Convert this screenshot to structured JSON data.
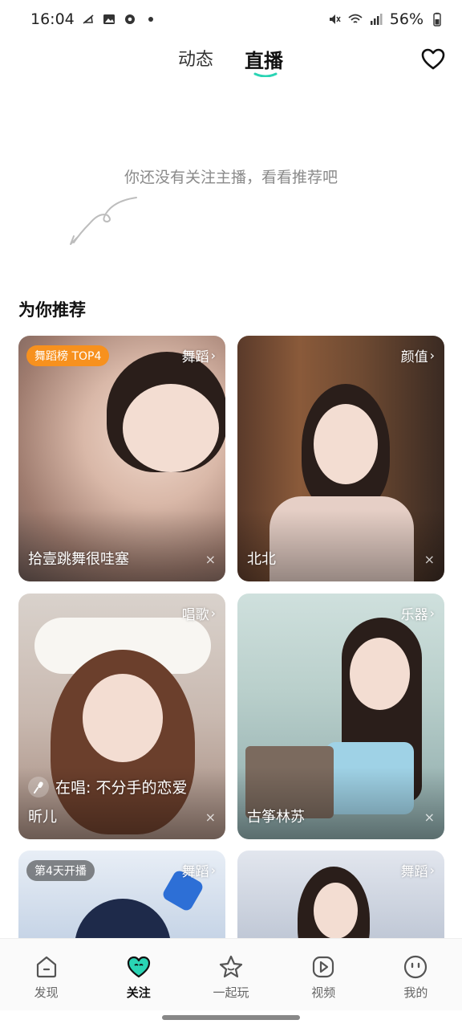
{
  "status_bar": {
    "time": "16:04",
    "battery": "56%",
    "left_icons": [
      "notification-muted-icon",
      "image-icon",
      "gear-icon",
      "dot-icon"
    ],
    "right_icons": [
      "vibrate-icon",
      "wifi-icon",
      "signal-icon",
      "battery-icon"
    ]
  },
  "header": {
    "tabs": [
      {
        "label": "动态",
        "active": false
      },
      {
        "label": "直播",
        "active": true
      }
    ],
    "accent_color": "#2ad4b4",
    "favorites_icon": "heart-icon"
  },
  "empty_state": {
    "message": "你还没有关注主播，看看推荐吧"
  },
  "recommend": {
    "title": "为你推荐",
    "cards": [
      {
        "badge": "舞蹈榜 TOP4",
        "category": "舞蹈",
        "name": "拾壹跳舞很哇塞"
      },
      {
        "badge": "",
        "category": "颜值",
        "name": "北北"
      },
      {
        "badge": "",
        "category": "唱歌",
        "name": "昕儿",
        "singing": "在唱: 不分手的恋爱"
      },
      {
        "badge": "",
        "category": "乐器",
        "name": "古筝林苏"
      },
      {
        "badge": "第4天开播",
        "category": "舞蹈",
        "name": ""
      },
      {
        "badge": "",
        "category": "舞蹈",
        "name": ""
      }
    ],
    "close_symbol": "×",
    "chevron": "›"
  },
  "bottom_nav": {
    "items": [
      {
        "label": "发现",
        "icon": "home-icon",
        "active": false
      },
      {
        "label": "关注",
        "icon": "heart-face-icon",
        "active": true
      },
      {
        "label": "一起玩",
        "icon": "star-icon",
        "active": false
      },
      {
        "label": "视频",
        "icon": "play-icon",
        "active": false
      },
      {
        "label": "我的",
        "icon": "profile-face-icon",
        "active": false
      }
    ]
  }
}
